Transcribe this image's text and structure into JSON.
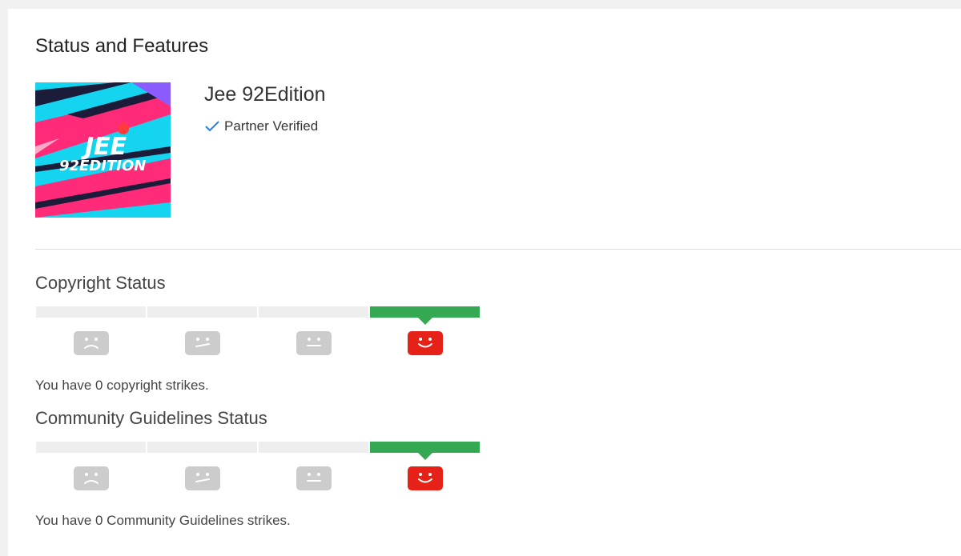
{
  "page": {
    "title": "Status and Features"
  },
  "channel": {
    "name": "Jee 92Edition",
    "avatar_text_line1": "JEE",
    "avatar_text_line2": "92EDITION",
    "partner_label": "Partner Verified"
  },
  "copyright": {
    "title": "Copyright Status",
    "strikes_text": "You have 0 copyright strikes.",
    "level_faces": [
      "sad-face-icon",
      "meh-face-icon",
      "neutral-face-icon",
      "happy-face-icon"
    ],
    "active_level": 4
  },
  "community": {
    "title": "Community Guidelines Status",
    "strikes_text": "You have 0 Community Guidelines strikes.",
    "level_faces": [
      "sad-face-icon",
      "meh-face-icon",
      "neutral-face-icon",
      "happy-face-icon"
    ],
    "active_level": 4
  },
  "colors": {
    "active_bar": "#34a853",
    "inactive_bar": "#eeeeee",
    "active_face": "#e62117",
    "inactive_face": "#cccccc",
    "check": "#2b7de9"
  }
}
